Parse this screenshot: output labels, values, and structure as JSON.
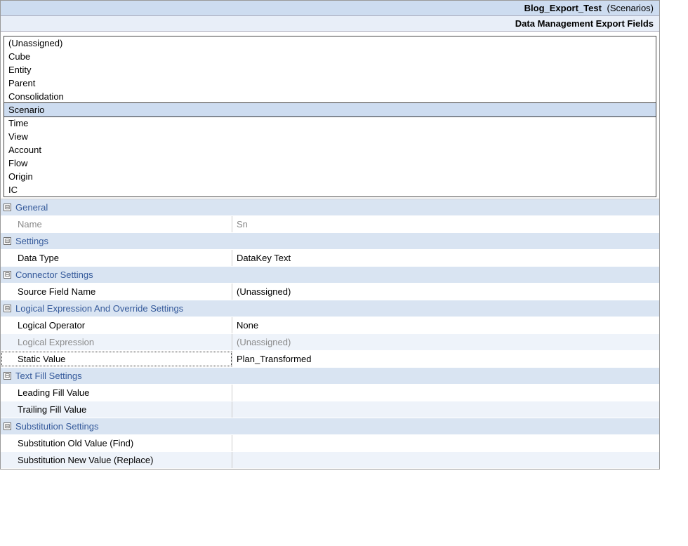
{
  "header": {
    "title_main": "Blog_Export_Test",
    "title_suffix": " (Scenarios)",
    "subtitle": "Data Management Export Fields"
  },
  "expander_glyph": "⊟",
  "list": {
    "items": [
      {
        "label": "(Unassigned)",
        "selected": false
      },
      {
        "label": "Cube",
        "selected": false
      },
      {
        "label": "Entity",
        "selected": false
      },
      {
        "label": "Parent",
        "selected": false
      },
      {
        "label": "Consolidation",
        "selected": false
      },
      {
        "label": "Scenario",
        "selected": true
      },
      {
        "label": "Time",
        "selected": false
      },
      {
        "label": "View",
        "selected": false
      },
      {
        "label": "Account",
        "selected": false
      },
      {
        "label": "Flow",
        "selected": false
      },
      {
        "label": "Origin",
        "selected": false
      },
      {
        "label": "IC",
        "selected": false
      }
    ]
  },
  "prop": {
    "general": {
      "title": "General",
      "name_label": "Name",
      "name_value": "Sn"
    },
    "settings": {
      "title": "Settings",
      "datatype_label": "Data Type",
      "datatype_value": "DataKey Text"
    },
    "connector": {
      "title": "Connector Settings",
      "source_label": "Source Field Name",
      "source_value": "(Unassigned)"
    },
    "logical": {
      "title": "Logical Expression And Override Settings",
      "op_label": "Logical Operator",
      "op_value": "None",
      "expr_label": "Logical Expression",
      "expr_value": "(Unassigned)",
      "static_label": "Static Value",
      "static_value": "Plan_Transformed"
    },
    "textfill": {
      "title": "Text Fill Settings",
      "lead_label": "Leading Fill Value",
      "lead_value": "",
      "trail_label": "Trailing Fill Value",
      "trail_value": ""
    },
    "subst": {
      "title": "Substitution Settings",
      "old_label": "Substitution Old Value (Find)",
      "old_value": "",
      "new_label": "Substitution New Value (Replace)",
      "new_value": ""
    }
  }
}
